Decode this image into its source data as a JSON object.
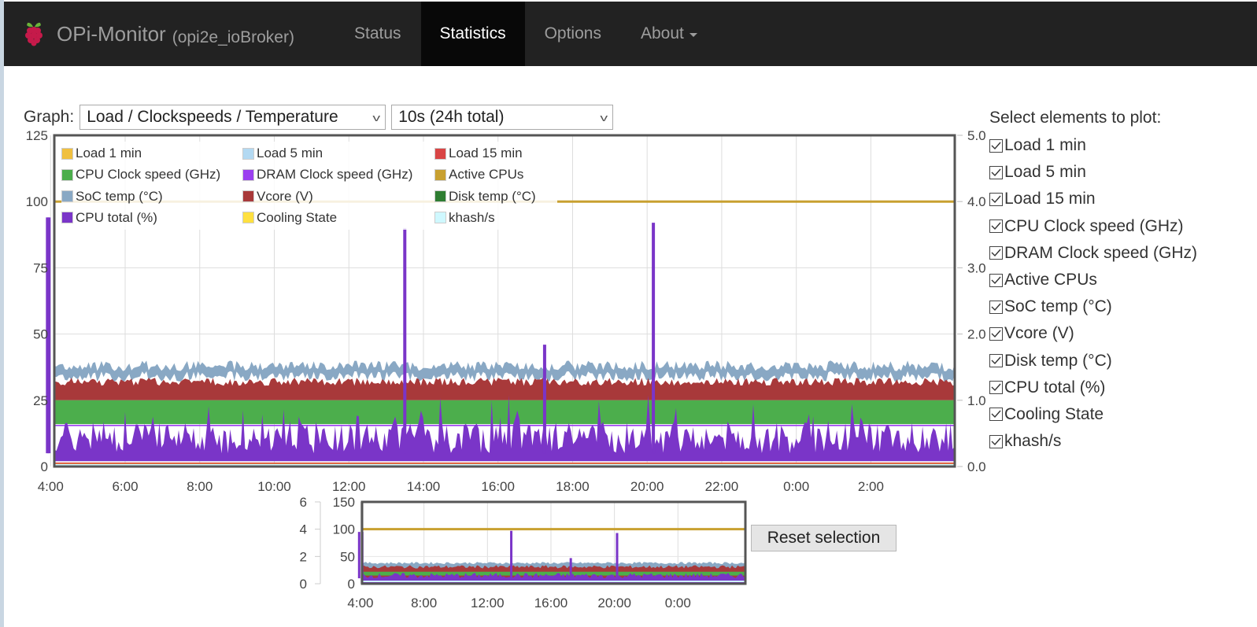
{
  "navbar": {
    "brand_title": "OPi-Monitor",
    "brand_subtitle": "(opi2e_ioBroker)",
    "logo_icon": "raspberry-icon",
    "items": [
      {
        "label": "Status",
        "active": false
      },
      {
        "label": "Statistics",
        "active": true
      },
      {
        "label": "Options",
        "active": false
      },
      {
        "label": "About",
        "active": false,
        "dropdown": true
      }
    ]
  },
  "controls": {
    "graph_label": "Graph:",
    "graph_select": "Load / Clockspeeds / Temperature",
    "interval_select": "10s (24h total)",
    "reset_button": "Reset selection"
  },
  "checklist": {
    "heading": "Select elements to plot:",
    "items": [
      {
        "label": "Load 1 min",
        "checked": true
      },
      {
        "label": "Load 5 min",
        "checked": true
      },
      {
        "label": "Load 15 min",
        "checked": true
      },
      {
        "label": "CPU Clock speed (GHz)",
        "checked": true
      },
      {
        "label": "DRAM Clock speed (GHz)",
        "checked": true
      },
      {
        "label": "Active CPUs",
        "checked": true
      },
      {
        "label": "SoC temp (°C)",
        "checked": true
      },
      {
        "label": "Vcore (V)",
        "checked": true
      },
      {
        "label": "Disk temp (°C)",
        "checked": true
      },
      {
        "label": "CPU total (%)",
        "checked": true
      },
      {
        "label": "Cooling State",
        "checked": true
      },
      {
        "label": "khash/s",
        "checked": true
      }
    ]
  },
  "chart_data": [
    {
      "type": "area",
      "title": "Load / Clockspeeds / Temperature",
      "legend_position": "top-left",
      "grid": true,
      "x_ticks": [
        "6:00",
        "8:00",
        "10:00",
        "12:00",
        "14:00",
        "16:00",
        "18:00",
        "20:00",
        "22:00",
        "0:00",
        "2:00",
        "4:00"
      ],
      "x_range_hours": [
        4.1,
        28.25
      ],
      "y_left": {
        "ticks": [
          0,
          25,
          50,
          75,
          100,
          125
        ],
        "range": [
          0,
          125
        ]
      },
      "y_right": {
        "ticks": [
          "0.0",
          "1.0",
          "2.0",
          "3.0",
          "4.0",
          "5.0"
        ],
        "range": [
          0,
          5
        ]
      },
      "series": [
        {
          "name": "Load 1 min",
          "color": "#f0c040",
          "axis": "right",
          "typical": 0.05
        },
        {
          "name": "Load 5 min",
          "color": "#b3d9f2",
          "axis": "right",
          "typical": 0.04
        },
        {
          "name": "Load 15 min",
          "color": "#d94545",
          "axis": "right",
          "typical": 0.03
        },
        {
          "name": "CPU Clock speed (GHz)",
          "color": "#4cae4c",
          "axis": "right",
          "band": [
            0.5,
            1.0
          ]
        },
        {
          "name": "DRAM Clock speed (GHz)",
          "color": "#9b3ff0",
          "axis": "right",
          "typical": 0.62
        },
        {
          "name": "Active CPUs",
          "color": "#c8a030",
          "axis": "right",
          "value": 4.0
        },
        {
          "name": "SoC temp (°C)",
          "color": "#89a8c4",
          "axis": "left",
          "typical": 36
        },
        {
          "name": "Vcore (V)",
          "color": "#a8393a",
          "axis": "right",
          "band": [
            1.0,
            1.3
          ]
        },
        {
          "name": "Disk temp (°C)",
          "color": "#2e7d32",
          "axis": "left",
          "typical": 0
        },
        {
          "name": "CPU total (%)",
          "color": "#7a35c8",
          "axis": "left",
          "typical": 10,
          "spikes": [
            {
              "time": "13:30",
              "value": 90
            },
            {
              "time": "17:15",
              "value": 46
            },
            {
              "time": "20:10",
              "value": 92
            },
            {
              "time": "3:55",
              "value": 94
            },
            {
              "time": "4:00",
              "value": 94
            }
          ]
        },
        {
          "name": "Cooling State",
          "color": "#ffe040",
          "axis": "left",
          "typical": 0
        },
        {
          "name": "khash/s",
          "color": "#cff8ff",
          "axis": "left",
          "typical": 0
        }
      ]
    },
    {
      "type": "area",
      "title": "overview",
      "x_ticks": [
        "8:00",
        "12:00",
        "16:00",
        "20:00",
        "0:00",
        "4:00"
      ],
      "y_left_outer": {
        "ticks": [
          0,
          2,
          4,
          6
        ],
        "range": [
          0,
          6
        ]
      },
      "y_left_inner": {
        "ticks": [
          0,
          50,
          100,
          150
        ],
        "range": [
          0,
          150
        ]
      },
      "active_cpus_value": 100,
      "spikes": [
        {
          "time": "13:30",
          "value": 97
        },
        {
          "time": "17:15",
          "value": 47
        },
        {
          "time": "20:10",
          "value": 93
        },
        {
          "time": "3:55",
          "value": 95
        }
      ]
    }
  ]
}
